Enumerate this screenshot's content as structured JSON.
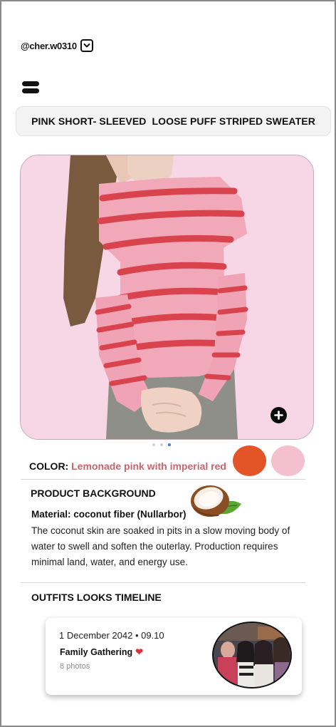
{
  "header": {
    "username": "@cher.w0310",
    "account_switch_icon": "chevron-down-icon",
    "menu_icon": "menu-icon"
  },
  "product": {
    "title": "PINK SHORT- SLEEVED  LOOSE PUFF STRIPED SWEATER",
    "image_background": "#f7d7e6",
    "add_icon": "plus-icon",
    "carousel": {
      "count": 3,
      "active": 3
    }
  },
  "color": {
    "label": "COLOR:",
    "value": "Lemonade pink with imperial red",
    "swatches": [
      {
        "name": "imperial red",
        "hex": "#e35427"
      },
      {
        "name": "lemonade pink",
        "hex": "#f4bfcf"
      }
    ]
  },
  "background": {
    "heading": "PRODUCT BACKGROUND",
    "material": "Material: coconut fiber (Nullarbor)",
    "description": "The coconut skin are soaked in pits  in a slow moving body of water to swell and soften the outerlay.  Production requires minimal land, water, and energy use."
  },
  "timeline": {
    "heading": "OUTFITS LOOKS TIMELINE",
    "entries": [
      {
        "date": "1 December 2042 • 09.10",
        "event": "Family Gathering",
        "photos": "8 photos"
      }
    ]
  }
}
